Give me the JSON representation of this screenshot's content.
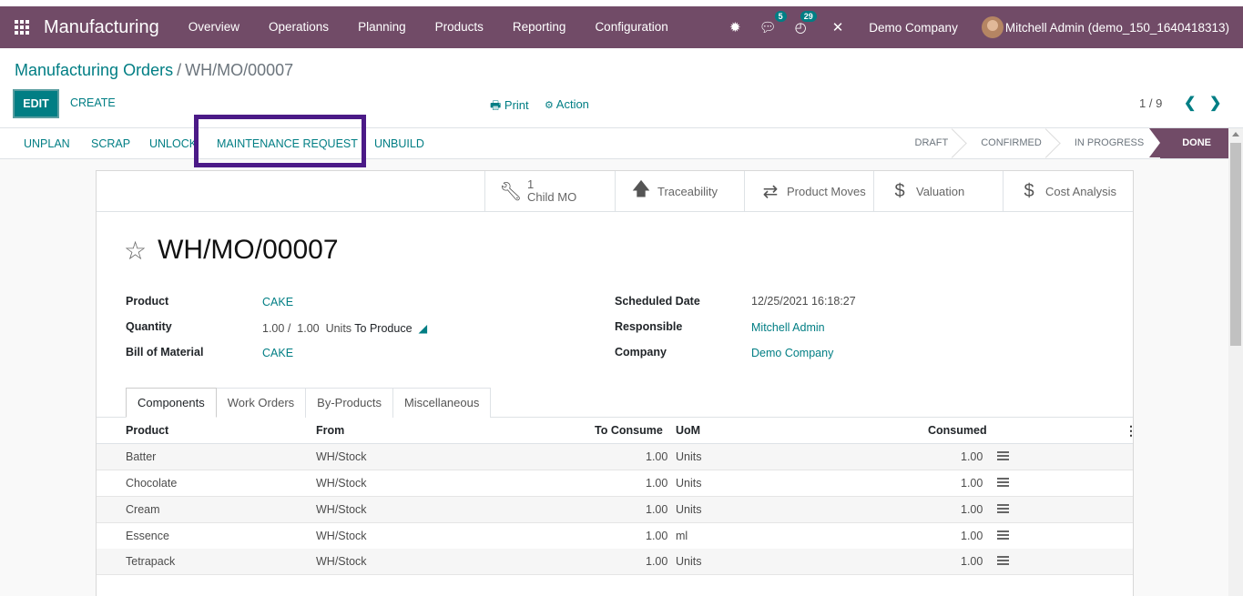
{
  "navbar": {
    "app_name": "Manufacturing",
    "menu": [
      "Overview",
      "Operations",
      "Planning",
      "Products",
      "Reporting",
      "Configuration"
    ],
    "messages_badge": "5",
    "activities_badge": "29",
    "company": "Demo Company",
    "user": "Mitchell Admin (demo_150_1640418313)"
  },
  "breadcrumb": {
    "parent": "Manufacturing Orders",
    "separator": "/",
    "current": "WH/MO/00007"
  },
  "toolbar": {
    "edit": "EDIT",
    "create": "CREATE",
    "print": "Print",
    "action": "Action",
    "pager": "1 / 9"
  },
  "statusbar": {
    "buttons": [
      "UNPLAN",
      "SCRAP",
      "UNLOCK",
      "MAINTENANCE REQUEST",
      "UNBUILD"
    ],
    "stages": [
      "DRAFT",
      "CONFIRMED",
      "IN PROGRESS",
      "DONE"
    ],
    "current_stage": "DONE"
  },
  "smart_buttons": {
    "child_mo_count": "1",
    "child_mo_label": "Child MO",
    "traceability": "Traceability",
    "product_moves": "Product Moves",
    "valuation": "Valuation",
    "cost_analysis": "Cost Analysis"
  },
  "record": {
    "title": "WH/MO/00007",
    "product_label": "Product",
    "product": "CAKE",
    "quantity_label": "Quantity",
    "quantity_produced": "1.00",
    "quantity_sep": "/",
    "quantity_total": "1.00",
    "quantity_uom": "Units",
    "quantity_suffix": "To Produce",
    "bom_label": "Bill of Material",
    "bom": "CAKE",
    "scheduled_label": "Scheduled Date",
    "scheduled": "12/25/2021 16:18:27",
    "responsible_label": "Responsible",
    "responsible": "Mitchell Admin",
    "company_label": "Company",
    "company": "Demo Company"
  },
  "tabs": [
    "Components",
    "Work Orders",
    "By-Products",
    "Miscellaneous"
  ],
  "components": {
    "headers": {
      "product": "Product",
      "from": "From",
      "to_consume": "To Consume",
      "uom": "UoM",
      "consumed": "Consumed"
    },
    "rows": [
      {
        "product": "Batter",
        "from": "WH/Stock",
        "to_consume": "1.00",
        "uom": "Units",
        "consumed": "1.00"
      },
      {
        "product": "Chocolate",
        "from": "WH/Stock",
        "to_consume": "1.00",
        "uom": "Units",
        "consumed": "1.00"
      },
      {
        "product": "Cream",
        "from": "WH/Stock",
        "to_consume": "1.00",
        "uom": "Units",
        "consumed": "1.00"
      },
      {
        "product": "Essence",
        "from": "WH/Stock",
        "to_consume": "1.00",
        "uom": "ml",
        "consumed": "1.00"
      },
      {
        "product": "Tetrapack",
        "from": "WH/Stock",
        "to_consume": "1.00",
        "uom": "Units",
        "consumed": "1.00"
      }
    ]
  },
  "colors": {
    "brand": "#714b67",
    "accent": "#017e84",
    "highlight": "#4b1a87"
  }
}
